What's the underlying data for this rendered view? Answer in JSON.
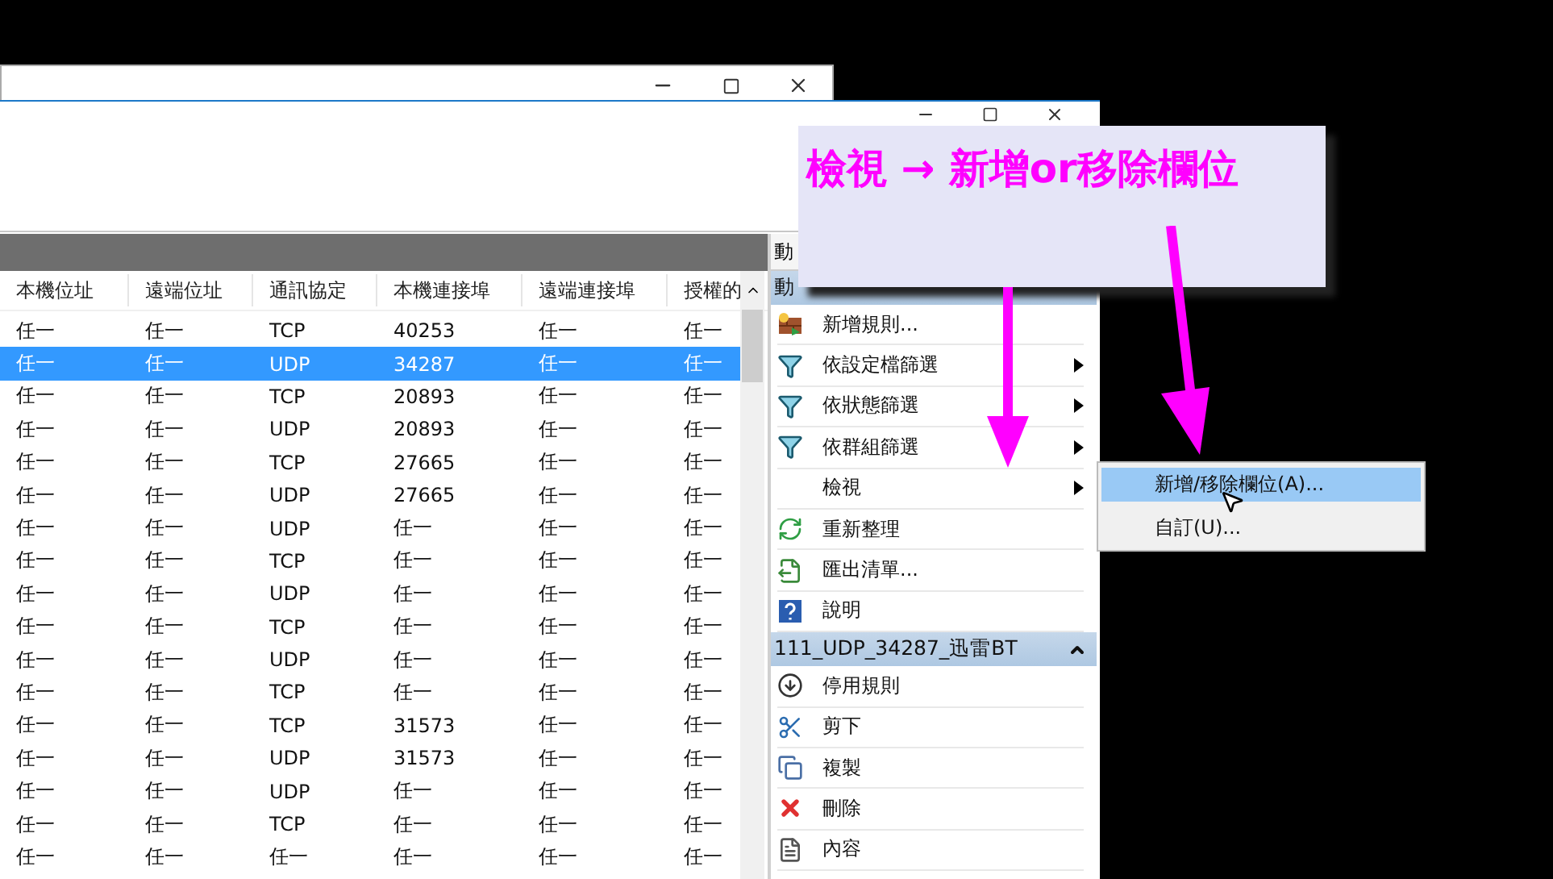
{
  "callout": {
    "text": "檢視 → 新增or移除欄位"
  },
  "table": {
    "columns": [
      "本機位址",
      "遠端位址",
      "通訊協定",
      "本機連接埠",
      "遠端連接埠",
      "授權的"
    ],
    "rows": [
      {
        "cells": [
          "任一",
          "任一",
          "TCP",
          "40253",
          "任一",
          "任一"
        ],
        "selected": false
      },
      {
        "cells": [
          "任一",
          "任一",
          "UDP",
          "34287",
          "任一",
          "任一"
        ],
        "selected": true
      },
      {
        "cells": [
          "任一",
          "任一",
          "TCP",
          "20893",
          "任一",
          "任一"
        ],
        "selected": false
      },
      {
        "cells": [
          "任一",
          "任一",
          "UDP",
          "20893",
          "任一",
          "任一"
        ],
        "selected": false
      },
      {
        "cells": [
          "任一",
          "任一",
          "TCP",
          "27665",
          "任一",
          "任一"
        ],
        "selected": false
      },
      {
        "cells": [
          "任一",
          "任一",
          "UDP",
          "27665",
          "任一",
          "任一"
        ],
        "selected": false
      },
      {
        "cells": [
          "任一",
          "任一",
          "UDP",
          "任一",
          "任一",
          "任一"
        ],
        "selected": false
      },
      {
        "cells": [
          "任一",
          "任一",
          "TCP",
          "任一",
          "任一",
          "任一"
        ],
        "selected": false
      },
      {
        "cells": [
          "任一",
          "任一",
          "UDP",
          "任一",
          "任一",
          "任一"
        ],
        "selected": false
      },
      {
        "cells": [
          "任一",
          "任一",
          "TCP",
          "任一",
          "任一",
          "任一"
        ],
        "selected": false
      },
      {
        "cells": [
          "任一",
          "任一",
          "UDP",
          "任一",
          "任一",
          "任一"
        ],
        "selected": false
      },
      {
        "cells": [
          "任一",
          "任一",
          "TCP",
          "任一",
          "任一",
          "任一"
        ],
        "selected": false
      },
      {
        "cells": [
          "任一",
          "任一",
          "TCP",
          "31573",
          "任一",
          "任一"
        ],
        "selected": false
      },
      {
        "cells": [
          "任一",
          "任一",
          "UDP",
          "31573",
          "任一",
          "任一"
        ],
        "selected": false
      },
      {
        "cells": [
          "任一",
          "任一",
          "UDP",
          "任一",
          "任一",
          "任一"
        ],
        "selected": false
      },
      {
        "cells": [
          "任一",
          "任一",
          "TCP",
          "任一",
          "任一",
          "任一"
        ],
        "selected": false
      },
      {
        "cells": [
          "任一",
          "任一",
          "任一",
          "任一",
          "任一",
          "任一"
        ],
        "selected": false
      }
    ]
  },
  "actions": {
    "tab": "動",
    "sections": [
      {
        "title": "動",
        "items": [
          {
            "label": "新增規則...",
            "submenu": false
          },
          {
            "label": "依設定檔篩選",
            "submenu": true
          },
          {
            "label": "依狀態篩選",
            "submenu": true
          },
          {
            "label": "依群組篩選",
            "submenu": true
          },
          {
            "label": "檢視",
            "submenu": true
          },
          {
            "label": "重新整理",
            "submenu": false
          },
          {
            "label": "匯出清單...",
            "submenu": false
          },
          {
            "label": "說明",
            "submenu": false
          }
        ]
      },
      {
        "title": "111_UDP_34287_迅雷BT",
        "expanded": true,
        "items": [
          {
            "label": "停用規則",
            "submenu": false
          },
          {
            "label": "剪下",
            "submenu": false
          },
          {
            "label": "複製",
            "submenu": false
          },
          {
            "label": "刪除",
            "submenu": false
          },
          {
            "label": "內容",
            "submenu": false
          }
        ]
      }
    ]
  },
  "submenu": {
    "items": [
      {
        "label": "新增/移除欄位(A)...",
        "selected": true
      },
      {
        "label": "自訂(U)...",
        "selected": false
      }
    ]
  }
}
